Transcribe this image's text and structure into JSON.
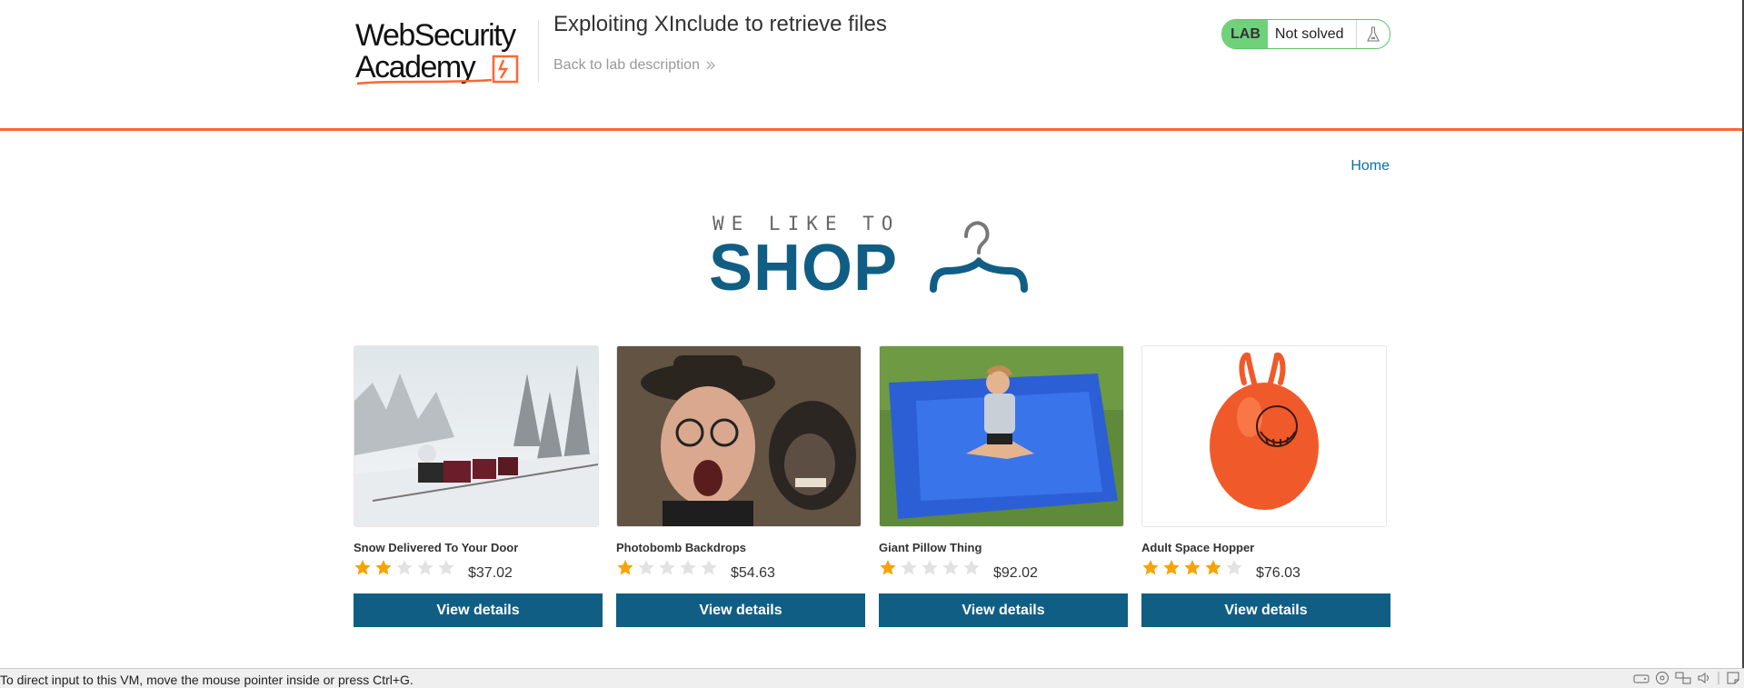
{
  "header": {
    "logo_alt": "Web Security Academy",
    "logo_line1": "WebSecurity",
    "logo_line2": "Academy",
    "lab_title": "Exploiting XInclude to retrieve files",
    "back_link": "Back to lab description",
    "lab_badge": "LAB",
    "lab_status": "Not solved"
  },
  "nav": {
    "home": "Home"
  },
  "shop_logo": {
    "tagline": "WE LIKE TO",
    "word": "SHOP"
  },
  "products": [
    {
      "name": "Snow Delivered To Your Door",
      "rating": 2,
      "price": "$37.02",
      "button": "View details",
      "image": "snow-train-image"
    },
    {
      "name": "Photobomb Backdrops",
      "rating": 1,
      "price": "$54.63",
      "button": "View details",
      "image": "man-and-monkey-image"
    },
    {
      "name": "Giant Pillow Thing",
      "rating": 1,
      "price": "$92.02",
      "button": "View details",
      "image": "girl-on-pillow-image"
    },
    {
      "name": "Adult Space Hopper",
      "rating": 4,
      "price": "$76.03",
      "button": "View details",
      "image": "space-hopper-image"
    }
  ],
  "vm_statusbar": {
    "message": "To direct input to this VM, move the mouse pointer inside or press Ctrl+G."
  },
  "colors": {
    "accent": "#ff6633",
    "primary": "#115e85",
    "link": "#0b6fa4",
    "star_filled": "#f7a300",
    "star_empty": "#e2e2e2",
    "lab_badge": "#6fd17a"
  }
}
